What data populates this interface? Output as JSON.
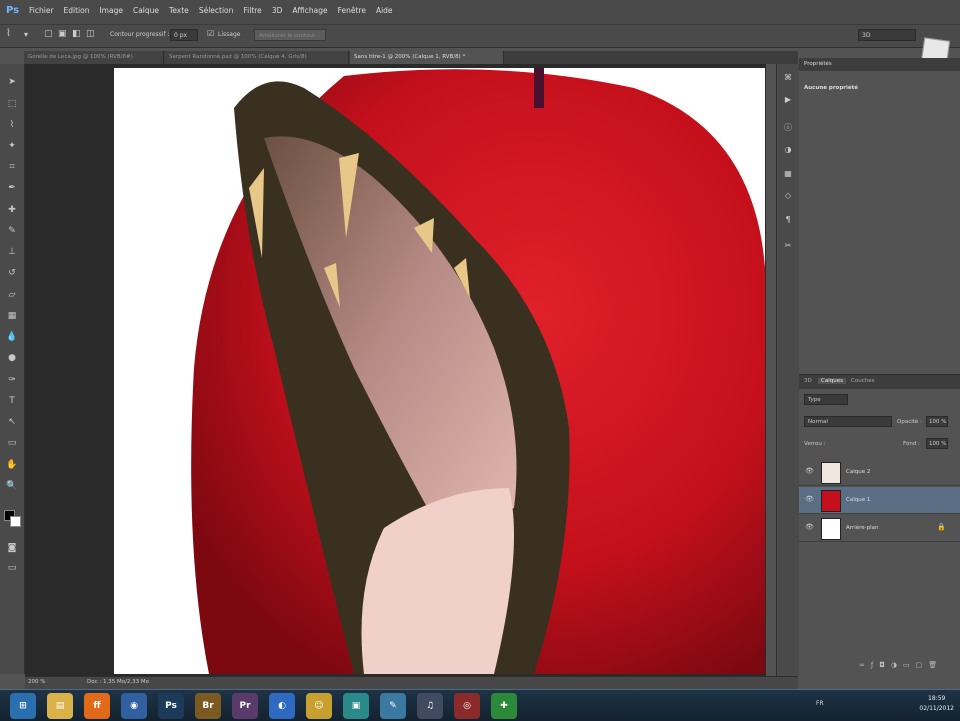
{
  "app": {
    "logo": "Ps"
  },
  "menu": [
    "Fichier",
    "Edition",
    "Image",
    "Calque",
    "Texte",
    "Sélection",
    "Filtre",
    "3D",
    "Affichage",
    "Fenêtre",
    "Aide"
  ],
  "options": {
    "contour_label": "Contour progressif :",
    "contour_value": "0 px",
    "lissage_label": "Lissage",
    "refine_label": "Améliorer le contour...",
    "workspace_value": "3D"
  },
  "tabs": [
    "Gorelle de Leca.jpg @ 100% (RVB/8#)",
    "Serpent Randonné.psd @ 100% (Calque 4, Gris/8)",
    "Sans titre-1 @ 200% (Calque 1, RVB/8) *"
  ],
  "properties": {
    "title": "Propriétés",
    "empty": "Aucune propriété"
  },
  "layers_panel": {
    "tabs": [
      "3D",
      "Calques",
      "Couches"
    ],
    "filter": "Type",
    "blend": "Normal",
    "opacity_label": "Opacité :",
    "opacity_value": "100 %",
    "lock_label": "Verrou :",
    "fill_label": "Fond :",
    "fill_value": "100 %",
    "layers": [
      {
        "name": "Calque 2",
        "selected": false
      },
      {
        "name": "Calque 1",
        "selected": true
      },
      {
        "name": "Arrière-plan",
        "selected": false
      }
    ]
  },
  "status": {
    "zoom": "200 %",
    "doc": "Doc : 1,35 Mo/2,33 Mo"
  },
  "taskbar": {
    "time": "18:59",
    "date": "02/11/2012",
    "lang": "FR",
    "apps": [
      {
        "name": "windows-start",
        "label": "⊞",
        "color": "#2a6fb0"
      },
      {
        "name": "explorer",
        "label": "▤",
        "color": "#d9b24a"
      },
      {
        "name": "firefox",
        "label": "ff",
        "color": "#e06a1a"
      },
      {
        "name": "app-blue",
        "label": "◉",
        "color": "#3060a0"
      },
      {
        "name": "photoshop",
        "label": "Ps",
        "color": "#1c3a5a"
      },
      {
        "name": "bridge",
        "label": "Br",
        "color": "#7a5a20"
      },
      {
        "name": "premiere",
        "label": "Pr",
        "color": "#5a3a6a"
      },
      {
        "name": "media",
        "label": "◐",
        "color": "#2d6ac0"
      },
      {
        "name": "app-yellow",
        "label": "☺",
        "color": "#c8a030"
      },
      {
        "name": "app-teal",
        "label": "▣",
        "color": "#2a8a8a"
      },
      {
        "name": "app-feather",
        "label": "✎",
        "color": "#3a7aa0"
      },
      {
        "name": "app-mic",
        "label": "♫",
        "color": "#404a60"
      },
      {
        "name": "app-red",
        "label": "◎",
        "color": "#8a2a2a"
      },
      {
        "name": "app-green",
        "label": "✚",
        "color": "#2a8a3a"
      }
    ]
  }
}
